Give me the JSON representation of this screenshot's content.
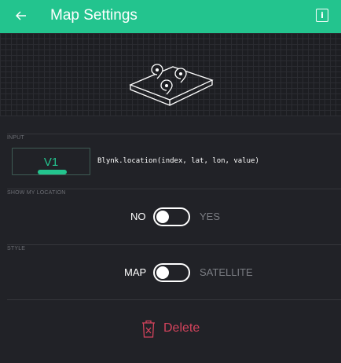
{
  "header": {
    "title": "Map Settings",
    "back_icon": "arrow-left-icon",
    "info_icon": "info-icon",
    "info_glyph": "i",
    "background_color": "#23c48e"
  },
  "banner": {
    "icon": "map-pins-icon"
  },
  "input": {
    "section_label": "INPUT",
    "pin": "V1",
    "code": "Blynk.location(index, lat, lon, value)",
    "accent_color": "#23c48e"
  },
  "show_location": {
    "section_label": "SHOW MY LOCATION",
    "off_label": "NO",
    "on_label": "YES",
    "enabled": false
  },
  "style": {
    "section_label": "STYLE",
    "off_label": "MAP",
    "on_label": "SATELLITE",
    "satellite": false
  },
  "delete": {
    "label": "Delete",
    "icon": "trash-icon",
    "color": "#d3435c"
  }
}
